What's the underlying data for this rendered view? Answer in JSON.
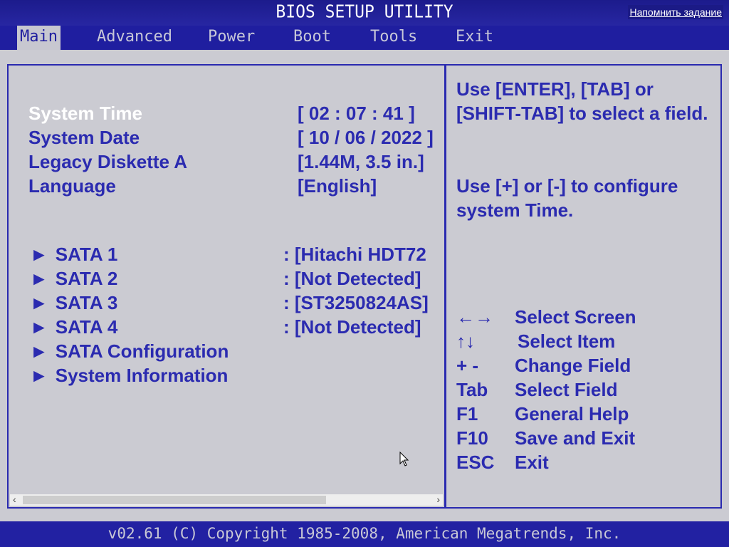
{
  "title": "BIOS SETUP UTILITY",
  "reminder": "Напомнить задание",
  "tabs": [
    {
      "label": "Main"
    },
    {
      "label": "Advanced"
    },
    {
      "label": "Power"
    },
    {
      "label": "Boot"
    },
    {
      "label": "Tools"
    },
    {
      "label": "Exit"
    }
  ],
  "settings": [
    {
      "label": "System Time",
      "value": "[ 02 : 07 : 41 ]"
    },
    {
      "label": "System Date",
      "value": "[ 10 / 06 / 2022 ]"
    },
    {
      "label": "Legacy Diskette A",
      "value": "[1.44M, 3.5 in.]"
    },
    {
      "label": "Language",
      "value": "[English]"
    }
  ],
  "submenus": [
    {
      "label": "SATA 1",
      "value": ": [Hitachi HDT72"
    },
    {
      "label": "SATA 2",
      "value": ": [Not Detected]"
    },
    {
      "label": "SATA 3",
      "value": ": [ST3250824AS]"
    },
    {
      "label": "SATA 4",
      "value": ": [Not Detected]"
    },
    {
      "label": "SATA Configuration",
      "value": ""
    },
    {
      "label": "System Information",
      "value": ""
    }
  ],
  "help": {
    "text1": "Use [ENTER], [TAB] or [SHIFT-TAB] to select a field.",
    "text2": "Use [+] or [-] to configure system Time."
  },
  "keys": [
    {
      "key": "←→",
      "desc": "Select Screen"
    },
    {
      "key": "↑↓",
      "desc": "Select Item"
    },
    {
      "key": "+ -",
      "desc": "Change Field"
    },
    {
      "key": "Tab",
      "desc": "Select Field"
    },
    {
      "key": "F1",
      "desc": "General Help"
    },
    {
      "key": "F10",
      "desc": "Save and Exit"
    },
    {
      "key": "ESC",
      "desc": "Exit"
    }
  ],
  "footer": "v02.61 (C) Copyright 1985-2008, American Megatrends, Inc.",
  "scroll": {
    "left": "‹",
    "right": "›"
  }
}
